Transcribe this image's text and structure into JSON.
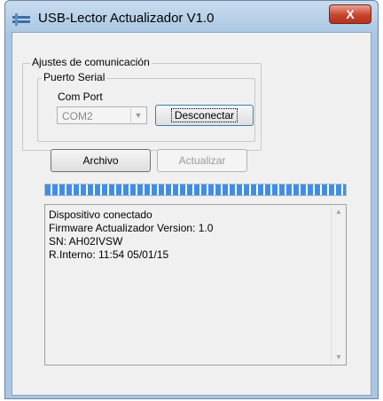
{
  "window": {
    "title": "USB-Lector Actualizador V1.0",
    "close_label": "X"
  },
  "comm_group": {
    "label": "Ajustes de comunicación",
    "serial": {
      "label": "Puerto Serial",
      "com_port_label": "Com Port",
      "com_port_value": "COM2",
      "disconnect_label": "Desconectar"
    }
  },
  "buttons": {
    "file_label": "Archivo",
    "update_label": "Actualizar"
  },
  "progress": {
    "fraction": 1.0
  },
  "log": {
    "lines": [
      "Dispositivo conectado",
      "Firmware Actualizador Version: 1.0",
      "SN: AH02IVSW",
      "R.Interno: 11:54 05/01/15"
    ]
  },
  "colors": {
    "progress": "#3f8ee6",
    "close": "#c7442c"
  }
}
